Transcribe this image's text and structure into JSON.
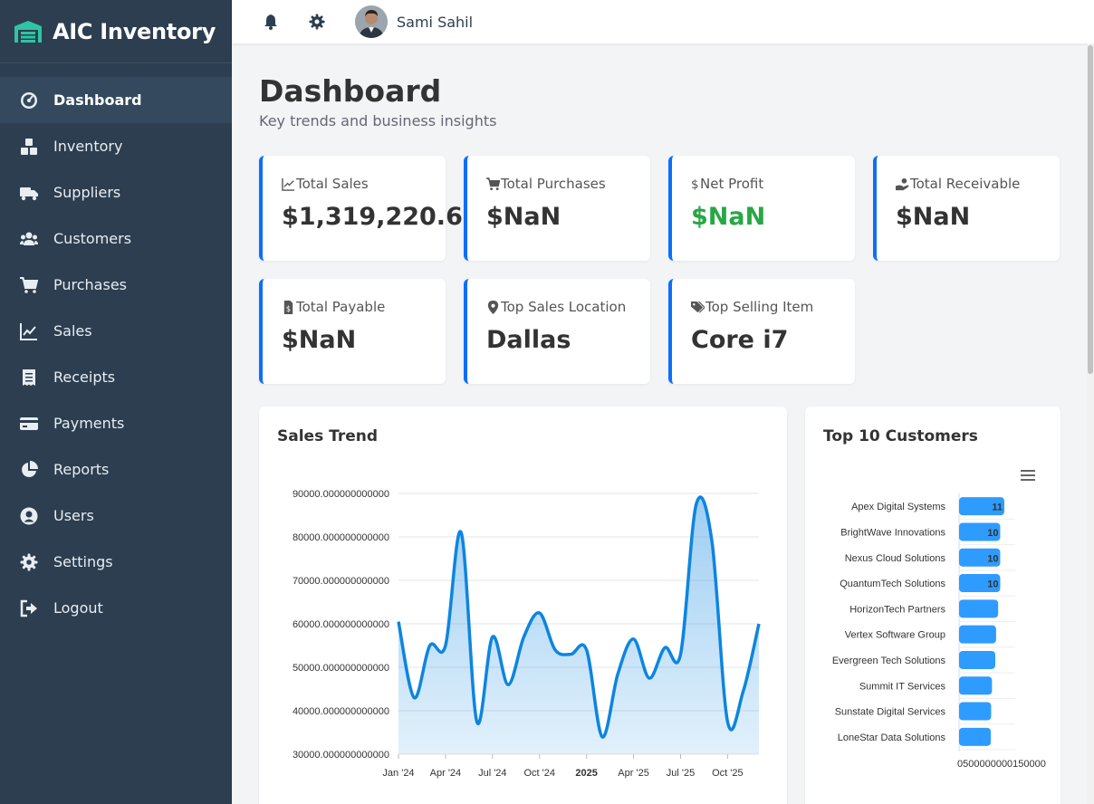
{
  "app": {
    "title": "AIC Inventory",
    "brand_color": "#2ec4a5"
  },
  "sidebar": {
    "items": [
      {
        "label": "Dashboard",
        "icon": "gauge-icon",
        "active": true
      },
      {
        "label": "Inventory",
        "icon": "boxes-icon"
      },
      {
        "label": "Suppliers",
        "icon": "truck-icon"
      },
      {
        "label": "Customers",
        "icon": "users-icon"
      },
      {
        "label": "Purchases",
        "icon": "cart-icon"
      },
      {
        "label": "Sales",
        "icon": "chart-line-icon"
      },
      {
        "label": "Receipts",
        "icon": "receipt-icon"
      },
      {
        "label": "Payments",
        "icon": "credit-card-icon"
      },
      {
        "label": "Reports",
        "icon": "pie-chart-icon"
      },
      {
        "label": "Users",
        "icon": "user-circle-icon"
      },
      {
        "label": "Settings",
        "icon": "gear-icon"
      },
      {
        "label": "Logout",
        "icon": "logout-icon"
      }
    ]
  },
  "topbar": {
    "user_name": "Sami Sahil",
    "icons": [
      "bell-icon",
      "gear-icon"
    ]
  },
  "page": {
    "title": "Dashboard",
    "subtitle": "Key trends and business insights"
  },
  "cards": [
    {
      "label": "Total Sales",
      "value": "$1,319,220.63",
      "icon": "chart-line-icon"
    },
    {
      "label": "Total Purchases",
      "value": "$NaN",
      "icon": "cart-icon"
    },
    {
      "label": "Net Profit",
      "value": "$NaN",
      "icon": "dollar-icon",
      "value_color": "#28a745"
    },
    {
      "label": "Total Receivable",
      "value": "$NaN",
      "icon": "hand-coin-icon"
    },
    {
      "label": "Total Payable",
      "value": "$NaN",
      "icon": "invoice-icon"
    },
    {
      "label": "Top Sales Location",
      "value": "Dallas",
      "icon": "map-pin-icon"
    },
    {
      "label": "Top Selling Item",
      "value": "Core i7",
      "icon": "tags-icon"
    }
  ],
  "sales_panel": {
    "title": "Sales Trend"
  },
  "customers_panel": {
    "title": "Top 10 Customers"
  },
  "chart_data": [
    {
      "type": "area",
      "title": "Sales Trend",
      "ylim": [
        30000,
        90000
      ],
      "y_ticks": [
        "90000.000000000000",
        "80000.000000000000",
        "70000.000000000000",
        "60000.000000000000",
        "50000.000000000000",
        "40000.000000000000",
        "30000.000000000000"
      ],
      "x_ticks": [
        "Jan '24",
        "Apr '24",
        "Jul '24",
        "Oct '24",
        "2025",
        "Apr '25",
        "Jul '25",
        "Oct '25"
      ],
      "x": [
        "2024-01",
        "2024-02",
        "2024-03",
        "2024-04",
        "2024-05",
        "2024-06",
        "2024-07",
        "2024-08",
        "2024-09",
        "2024-10",
        "2024-11",
        "2024-12",
        "2025-01",
        "2025-02",
        "2025-03",
        "2025-04",
        "2025-05",
        "2025-06",
        "2025-07",
        "2025-08",
        "2025-09",
        "2025-10",
        "2025-11",
        "2025-12"
      ],
      "values": [
        60500,
        43000,
        55000,
        55000,
        81000,
        37500,
        57000,
        46000,
        57000,
        62500,
        54000,
        53000,
        54000,
        34000,
        48500,
        56500,
        47500,
        54500,
        53000,
        87500,
        79000,
        37500,
        44500,
        60000
      ],
      "color": "#0d85e0",
      "grid": true
    },
    {
      "type": "bar",
      "orientation": "horizontal",
      "title": "Top 10 Customers",
      "categories": [
        "Apex Digital Systems",
        "BrightWave Innovations",
        "Nexus Cloud Solutions",
        "QuantumTech Solutions",
        "HorizonTech Partners",
        "Vertex Software Group",
        "Evergreen Tech Solutions",
        "Summit IT Services",
        "Sunstate Digital Services",
        "LoneStar Data Solutions"
      ],
      "values": [
        11,
        10,
        10,
        10,
        9.5,
        9,
        8.8,
        8,
        7.8,
        7.7
      ],
      "data_labels": [
        "11",
        "10",
        "10",
        "10",
        "",
        "",
        "",
        "",
        "",
        ""
      ],
      "x_tick_text": "0500000000150000",
      "color": "#2e9bff",
      "grid": true
    }
  ]
}
